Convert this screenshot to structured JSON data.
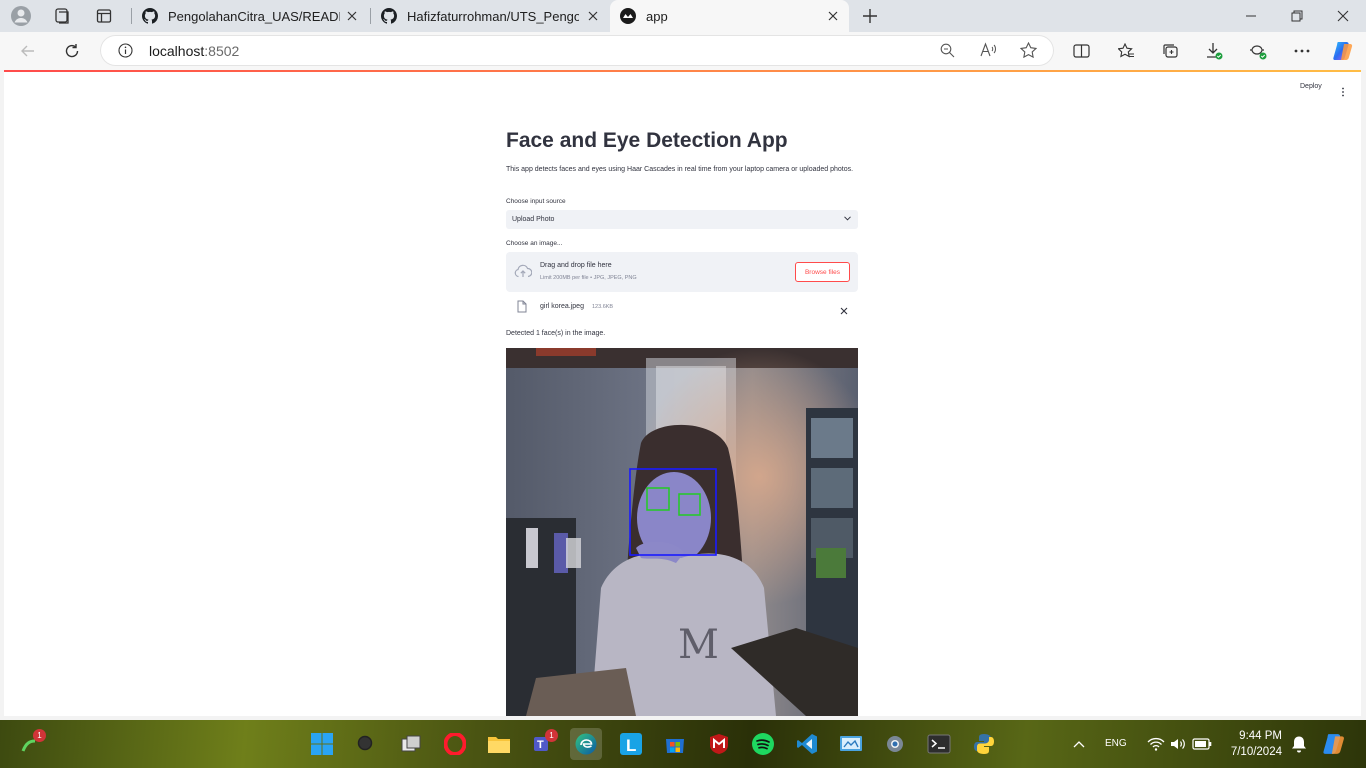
{
  "browser": {
    "tabs": [
      {
        "title": "PengolahanCitra_UAS/README.m",
        "active": false,
        "icon": "github-icon"
      },
      {
        "title": "Hafizfaturrohman/UTS_Pengolah",
        "active": false,
        "icon": "github-icon"
      },
      {
        "title": "app",
        "active": true,
        "icon": "streamlit-icon"
      }
    ],
    "address": {
      "host": "localhost",
      "port": ":8502"
    }
  },
  "app": {
    "deploy_label": "Deploy",
    "title": "Face and Eye Detection App",
    "description": "This app detects faces and eyes using Haar Cascades in real time from your laptop camera or uploaded photos.",
    "input_source_label": "Choose input source",
    "input_source_value": "Upload Photo",
    "uploader_label": "Choose an image...",
    "dropzone_title": "Drag and drop file here",
    "dropzone_limit": "Limit 200MB per file • JPG, JPEG, PNG",
    "browse_label": "Browse files",
    "file_name": "girl korea.jpeg",
    "file_size": "123.6KB",
    "result_text": "Detected 1 face(s) in the image."
  },
  "taskbar": {
    "time": "9:44 PM",
    "date": "7/10/2024",
    "language": "ENG",
    "notifications_badge": "1",
    "teams_badge": "1"
  },
  "colors": {
    "accent": "#ff4b4b",
    "face_box": "#1a1aff",
    "eye_box": "#22cc22"
  }
}
